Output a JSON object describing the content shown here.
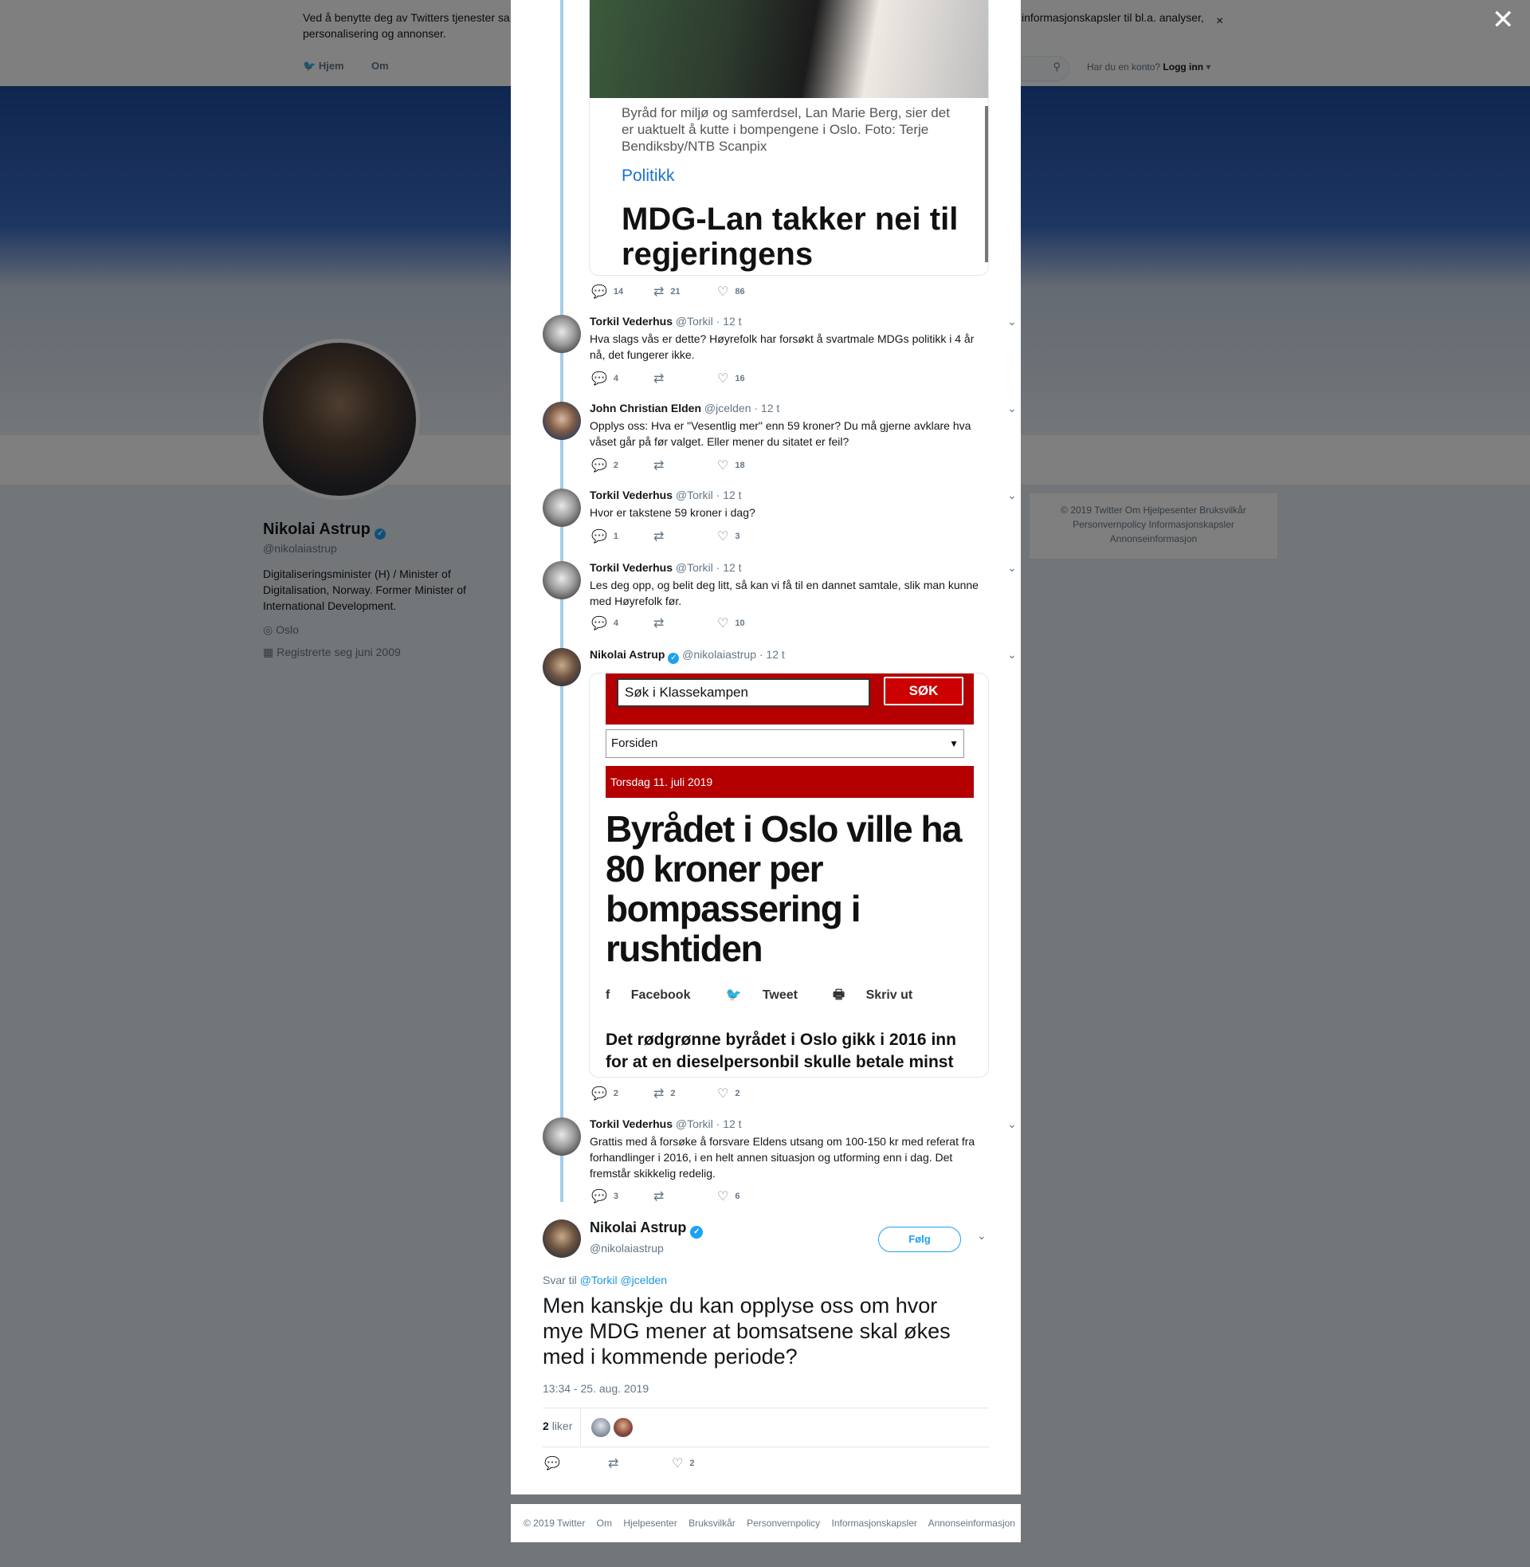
{
  "background": {
    "cookie_text": "Ved å benytte deg av Twitters tjenester sa",
    "cookie_text2": "informasjonskapsler til bl.a. analyser,",
    "cookie_text3": "personalisering og annonser.",
    "cookie_close": "×",
    "nav_home": "Hjem",
    "nav_about": "Om",
    "login_prompt": "Har du en konto?",
    "login_label": "Logg inn",
    "profile_name": "Nikolai Astrup",
    "profile_handle": "@nikolaiastrup",
    "profile_bio": "Digitaliseringsminister (H) / Minister of Digitalisation, Norway. Former Minister of International Development.",
    "profile_location": "Oslo",
    "profile_joined": "Registrerte seg juni 2009",
    "footer_lines": [
      "© 2019 Twitter   Om   Hjelpesenter   Bruksvilkår",
      "Personvernpolicy   Informasjonskapsler",
      "Annonseinformasjon"
    ]
  },
  "modal_close": "✕",
  "card1": {
    "caption": "Byråd for miljø og samferdsel, Lan Marie Berg, sier det er uaktuelt å kutte i bompengene i Oslo. Foto: Terje Bendiksby/NTB Scanpix",
    "section": "Politikk",
    "headline": "MDG-Lan takker nei til regjeringens"
  },
  "card1_actions": {
    "replies": "14",
    "retweets": "21",
    "likes": "86"
  },
  "tweets": [
    {
      "name": "Torkil Vederhus",
      "handle": "@Torkil",
      "time": "· 12 t",
      "text": "Hva slags vås er dette? Høyrefolk har forsøkt å svartmale MDGs politikk i 4 år nå, det fungerer ikke.",
      "replies": "4",
      "retweets": "",
      "likes": "16"
    },
    {
      "name": "John Christian Elden",
      "handle": "@jcelden",
      "time": "· 12 t",
      "text": "Opplys oss: Hva er \"Vesentlig mer\" enn 59 kroner? Du må gjerne avklare hva våset går på før valget. Eller mener du sitatet er feil?",
      "replies": "2",
      "retweets": "",
      "likes": "18"
    },
    {
      "name": "Torkil Vederhus",
      "handle": "@Torkil",
      "time": "· 12 t",
      "text": "Hvor er takstene 59 kroner i dag?",
      "replies": "1",
      "retweets": "",
      "likes": "3"
    },
    {
      "name": "Torkil Vederhus",
      "handle": "@Torkil",
      "time": "· 12 t",
      "text": "Les deg opp, og belit deg litt, så kan vi få til en dannet samtale, slik man kunne med Høyrefolk før.",
      "replies": "4",
      "retweets": "",
      "likes": "10"
    },
    {
      "name": "Nikolai Astrup",
      "handle": "@nikolaiastrup",
      "time": "· 12 t",
      "text": "",
      "replies": "2",
      "retweets": "2",
      "likes": "2"
    },
    {
      "name": "Torkil Vederhus",
      "handle": "@Torkil",
      "time": "· 12 t",
      "text": "Grattis med å forsøke å forsvare Eldens utsang om 100-150 kr med referat fra forhandlinger i 2016, i en helt annen situasjon og utforming enn i dag. Det fremstår skikkelig redelig.",
      "replies": "3",
      "retweets": "",
      "likes": "6"
    }
  ],
  "card2": {
    "search_placeholder": "Søk i Klassekampen",
    "search_button": "SØK",
    "select_value": "Forsiden",
    "date": "Torsdag 11. juli 2019",
    "headline": "Byrådet i Oslo ville ha 80 kroner per bompassering i rushtiden",
    "share_facebook": "Facebook",
    "share_tweet": "Tweet",
    "share_print": "Skriv ut",
    "lead": "Det rødgrønne byrådet i Oslo gikk i 2016 inn for at en dieselpersonbil skulle betale minst"
  },
  "main_tweet": {
    "name": "Nikolai Astrup",
    "handle": "@nikolaiastrup",
    "follow_label": "Følg",
    "reply_prefix": "Svar til",
    "reply_user1": "@Torkil",
    "reply_user2": "@jcelden",
    "text": "Men kanskje du kan opplyse oss om hvor mye MDG mener at bomsatsene skal økes med i kommende periode?",
    "timestamp": "13:34 - 25. aug. 2019",
    "likes_count": "2",
    "likes_label": "liker",
    "action_likes": "2"
  },
  "footer": [
    "© 2019 Twitter",
    "Om",
    "Hjelpesenter",
    "Bruksvilkår",
    "Personvernpolicy",
    "Informasjonskapsler",
    "Annonseinformasjon"
  ],
  "colors": {
    "accent": "#1da1f2",
    "thread": "#a5cde9",
    "newspaper_red": "#b40000"
  }
}
